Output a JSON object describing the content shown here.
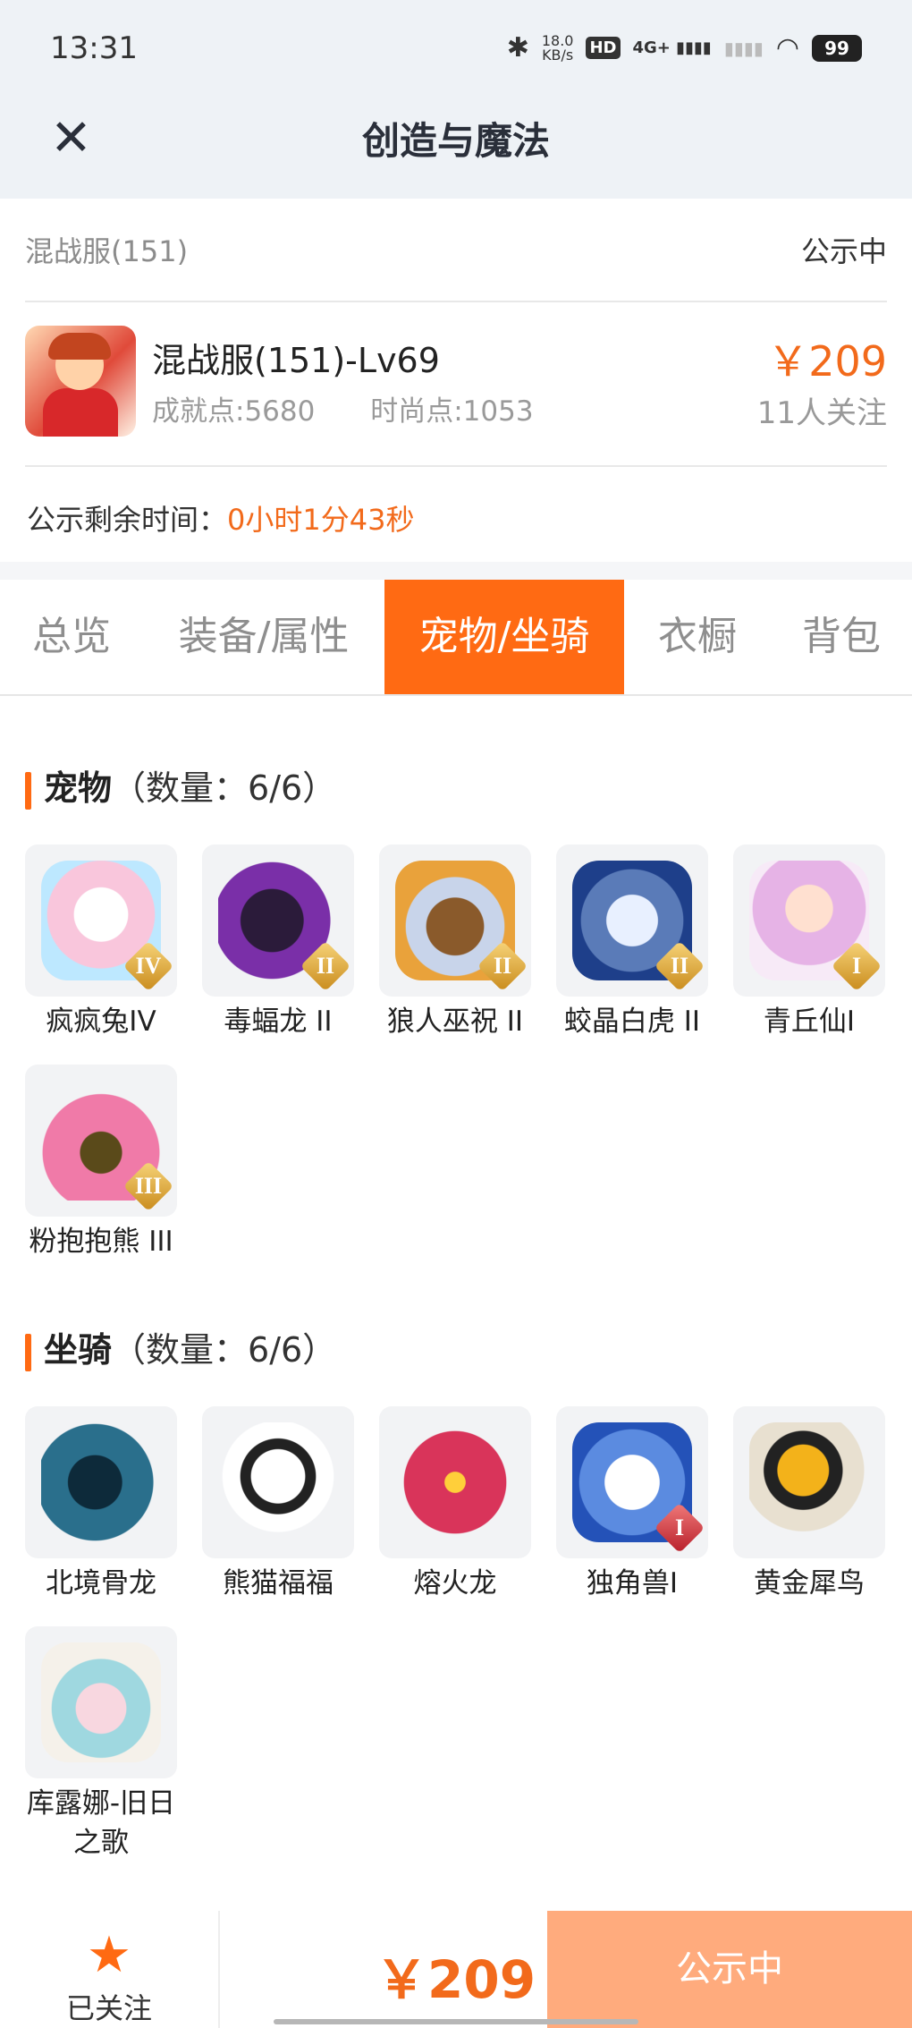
{
  "status_bar": {
    "time": "13:31",
    "speed": "18.0",
    "speed_unit": "KB/s",
    "hd": "HD",
    "network": "4G+",
    "battery": "99"
  },
  "nav": {
    "title": "创造与魔法"
  },
  "listing": {
    "server": "混战服(151)",
    "status": "公示中",
    "character_name": "混战服(151)-Lv69",
    "achievement": "成就点:5680",
    "fashion": "时尚点:1053",
    "price": "￥209",
    "watchers": "11人关注",
    "timer_label": "公示剩余时间：",
    "timer_value": "0小时1分43秒"
  },
  "tabs": [
    {
      "label": "总览"
    },
    {
      "label": "装备/属性"
    },
    {
      "label": "宠物/坐骑"
    },
    {
      "label": "衣橱"
    },
    {
      "label": "背包"
    }
  ],
  "pets": {
    "title": "宠物",
    "count": "（数量：6/6）",
    "items": [
      {
        "name": "疯疯兔IV",
        "tier": "IV"
      },
      {
        "name": "毒蝠龙 II",
        "tier": "II"
      },
      {
        "name": "狼人巫祝 II",
        "tier": "II"
      },
      {
        "name": "蛟晶白虎 II",
        "tier": "II"
      },
      {
        "name": "青丘仙I",
        "tier": "I"
      },
      {
        "name": "粉抱抱熊 III",
        "tier": "III"
      }
    ]
  },
  "mounts": {
    "title": "坐骑",
    "count": "（数量：6/6）",
    "items": [
      {
        "name": "北境骨龙"
      },
      {
        "name": "熊猫福福"
      },
      {
        "name": "熔火龙"
      },
      {
        "name": "独角兽I",
        "tier": "I"
      },
      {
        "name": "黄金犀鸟"
      },
      {
        "name": "库露娜-旧日之歌"
      }
    ]
  },
  "bottom_bar": {
    "follow_label": "已关注",
    "price": "￥209",
    "status_button": "公示中"
  },
  "colors": {
    "accent": "#ff6a13",
    "price": "#f26a1b",
    "status_button": "#ffab7d"
  }
}
